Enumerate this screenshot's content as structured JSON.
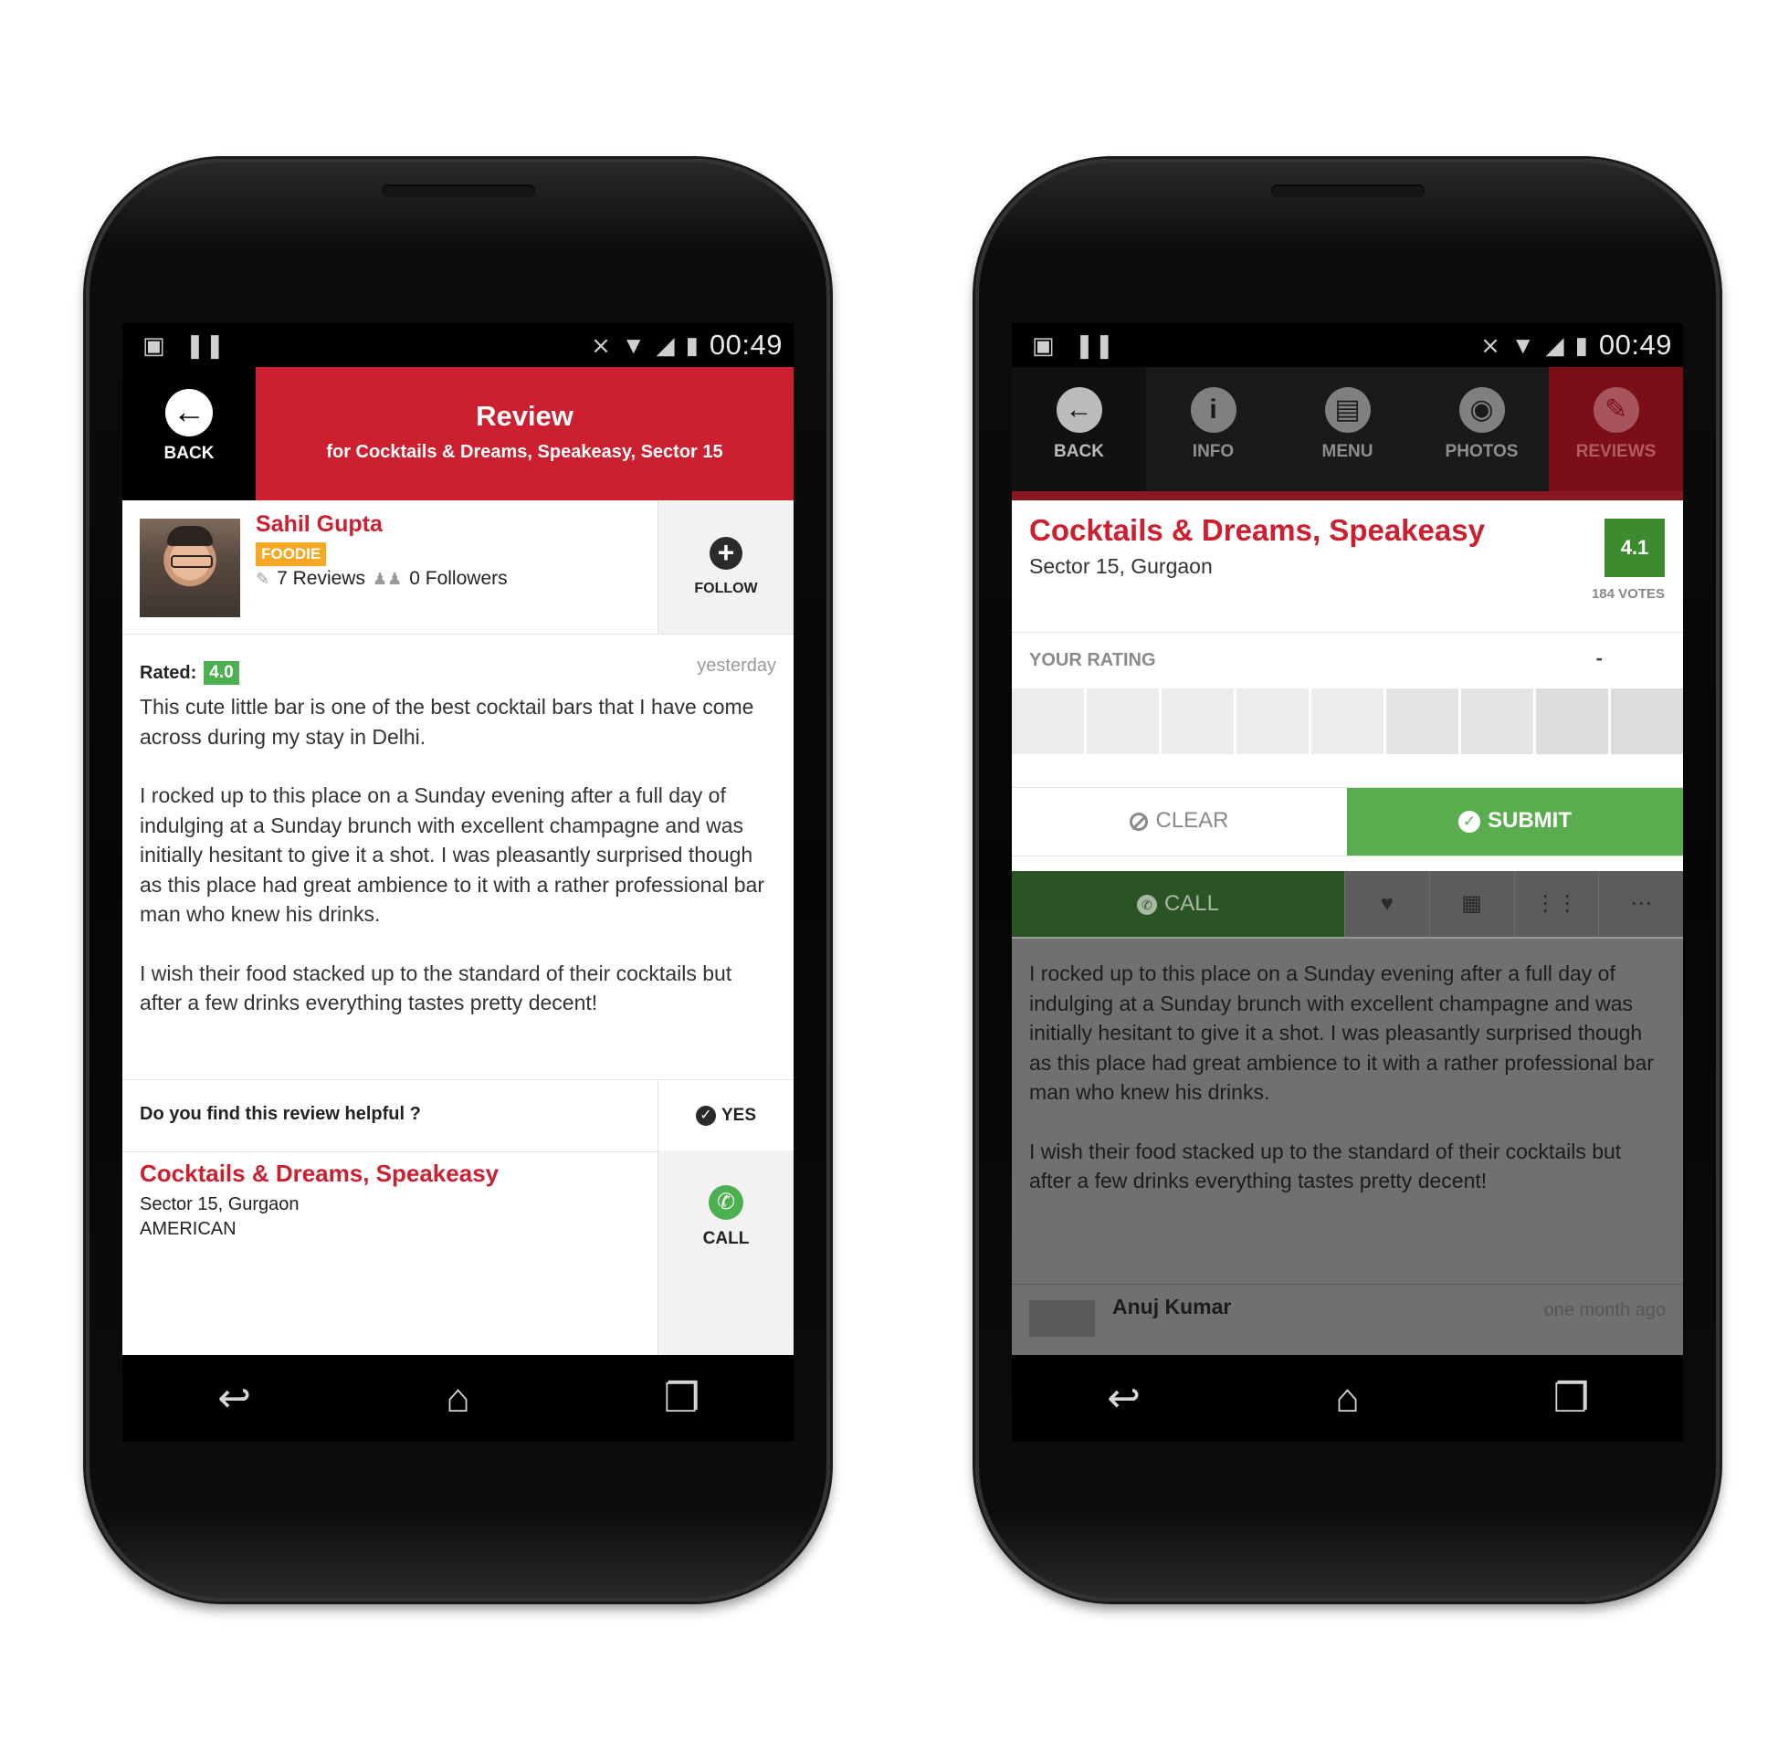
{
  "status_bar": {
    "time": "00:49"
  },
  "left_screen": {
    "header": {
      "back_label": "BACK",
      "title": "Review",
      "subtitle": "for Cocktails & Dreams, Speakeasy, Sector 15"
    },
    "user": {
      "name": "Sahil Gupta",
      "badge": "FOODIE",
      "reviews": "7 Reviews",
      "followers": "0 Followers",
      "follow_label": "FOLLOW"
    },
    "review": {
      "rated_label": "Rated:",
      "rating": "4.0",
      "time": "yesterday",
      "paragraphs": [
        "This cute little bar is one of the best cocktail bars that I have come across during my stay in Delhi.",
        "I rocked up to this place on a Sunday evening after a full day of indulging at a Sunday brunch with excellent champagne and was initially hesitant to give it a shot.  I was pleasantly surprised though as this place had great ambience to it with a rather professional bar man who knew his drinks.",
        "I wish their food stacked up to the standard of their cocktails but after a few drinks everything tastes pretty decent!"
      ]
    },
    "helpful": {
      "question": "Do you find this review helpful ?",
      "yes_label": "YES"
    },
    "restaurant": {
      "name": "Cocktails & Dreams, Speakeasy",
      "location": "Sector 15, Gurgaon",
      "cuisine": "AMERICAN",
      "call_label": "CALL"
    }
  },
  "right_screen": {
    "tabs": [
      {
        "label": "BACK",
        "icon": "back-arrow-icon"
      },
      {
        "label": "INFO",
        "icon": "info-icon"
      },
      {
        "label": "MENU",
        "icon": "menu-icon"
      },
      {
        "label": "PHOTOS",
        "icon": "camera-icon"
      },
      {
        "label": "REVIEWS",
        "icon": "pencil-icon"
      }
    ],
    "restaurant": {
      "name": "Cocktails & Dreams, Speakeasy",
      "location": "Sector 15, Gurgaon",
      "score": "4.1",
      "votes": "184 VOTES"
    },
    "your_rating": {
      "label": "YOUR RATING",
      "value": "-"
    },
    "actions": {
      "clear_label": "CLEAR",
      "submit_label": "SUBMIT"
    },
    "bottom_bar": {
      "call_label": "CALL"
    },
    "review_paragraphs": [
      "I rocked up to this place on a Sunday evening after a full day of indulging at a Sunday brunch with excellent champagne and was initially hesitant to give it a shot.  I was pleasantly surprised though as this place had great ambience to it with a rather professional bar man who knew his drinks.",
      "I wish their food stacked up to the standard of their cocktails but after a few drinks everything tastes pretty decent!"
    ],
    "next_review": {
      "name": "Anuj Kumar",
      "time": "one month ago"
    }
  },
  "colors": {
    "brand_red": "#cc1f2f",
    "rating_green": "#4caf50",
    "submit_green": "#5aad4e",
    "foodie_orange": "#f7a823"
  }
}
